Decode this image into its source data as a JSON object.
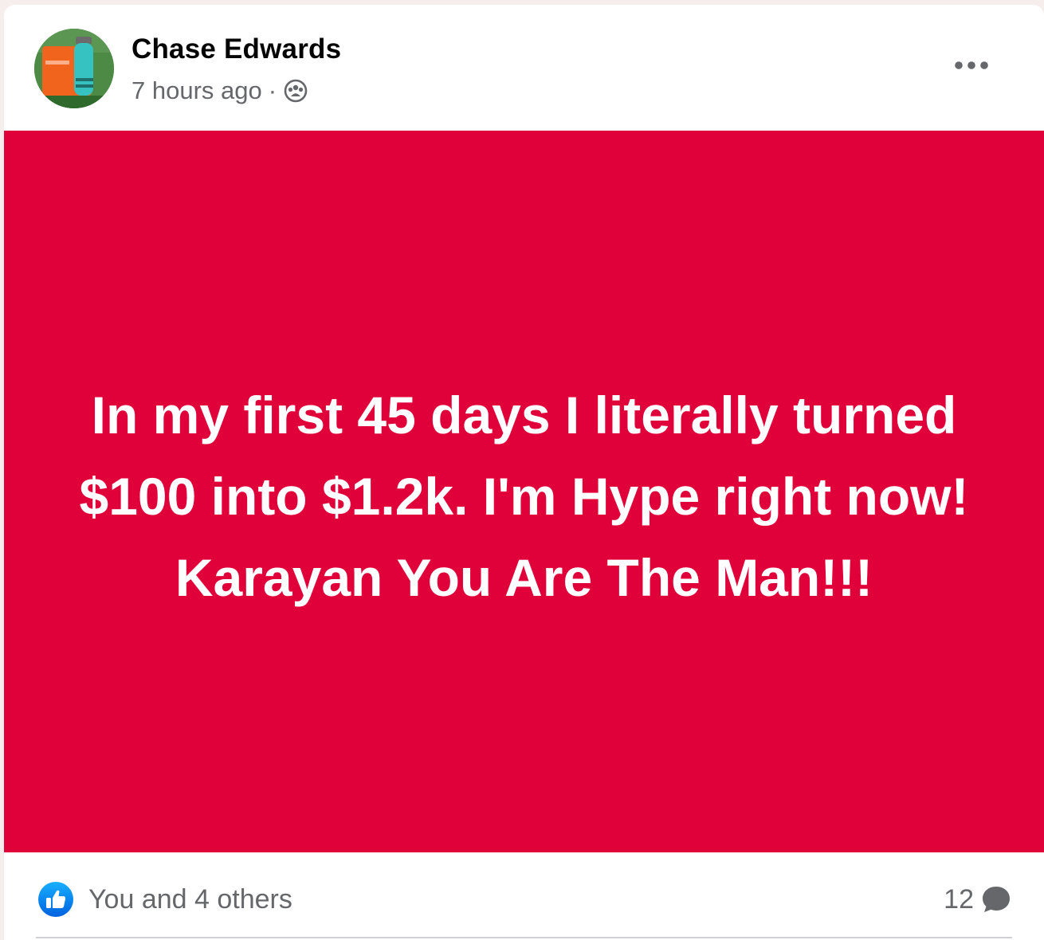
{
  "post": {
    "author": "Chase Edwards",
    "timestamp": "7 hours ago",
    "separator": "·",
    "audience_icon": "friends-icon",
    "more_icon": "more-horizontal-icon",
    "background_color": "#e0003a",
    "text": "In my first 45 days I literally turned $100 into $1.2k. I'm Hype right now! Karayan You Are The Man!!!"
  },
  "footer": {
    "like_icon": "like-thumb-icon",
    "reactions_text": "You and 4 others",
    "comments_count": "12",
    "comment_icon": "comment-bubble-icon"
  },
  "colors": {
    "accent_blue": "#1877f2",
    "muted_text": "#65676b"
  }
}
